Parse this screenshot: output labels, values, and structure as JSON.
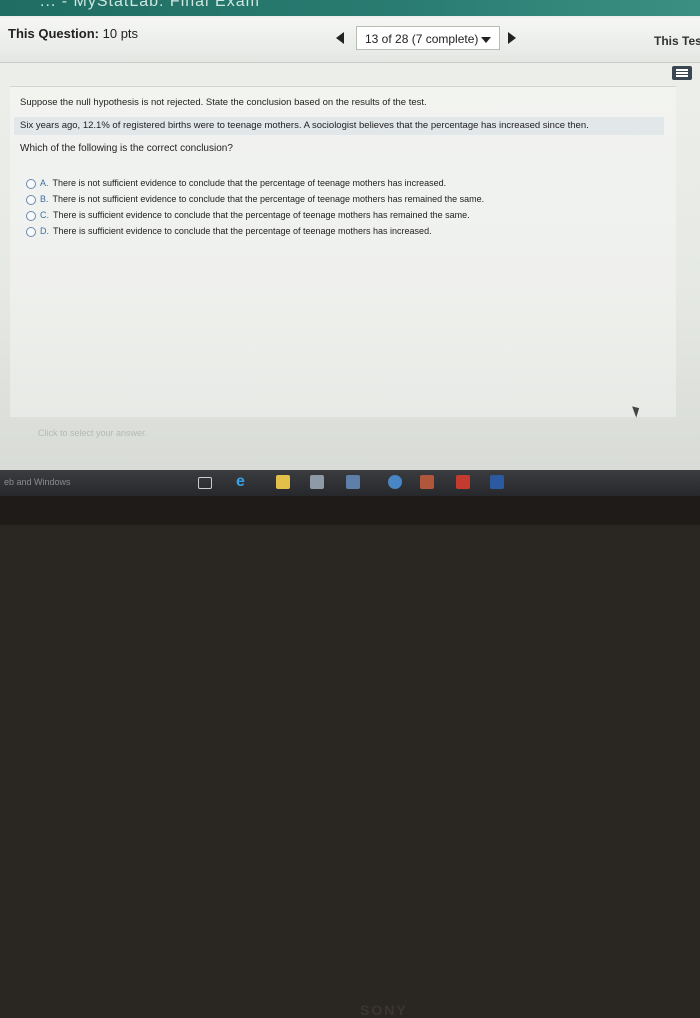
{
  "window": {
    "banner_text": "... - MyStatLab: Final Exam"
  },
  "header": {
    "question_label": "This Question:",
    "points": "10 pts",
    "progress": "13 of 28 (7 complete)",
    "this_test": "This Tes"
  },
  "question": {
    "instruction": "Suppose the null hypothesis is not rejected. State the conclusion based on the results of the test.",
    "scenario": "Six years ago, 12.1% of registered births were to teenage mothers. A sociologist believes that the percentage has increased since then.",
    "prompt": "Which of the following is the correct conclusion?",
    "options": [
      {
        "letter": "A.",
        "text": "There is not sufficient evidence to conclude that the percentage of teenage mothers has increased."
      },
      {
        "letter": "B.",
        "text": "There is not sufficient evidence to conclude that the percentage of teenage mothers has remained the same."
      },
      {
        "letter": "C.",
        "text": "There is sufficient evidence to conclude that the percentage of teenage mothers has remained the same."
      },
      {
        "letter": "D.",
        "text": "There is sufficient evidence to conclude that the percentage of teenage mothers has increased."
      }
    ]
  },
  "footer": {
    "hint": "Click to select your answer."
  },
  "taskbar": {
    "search_text": "eb and Windows"
  },
  "bezel": {
    "brand": "SONY"
  },
  "colors": {
    "accent": "#3a6fa8",
    "banner": "#2a7d72"
  }
}
